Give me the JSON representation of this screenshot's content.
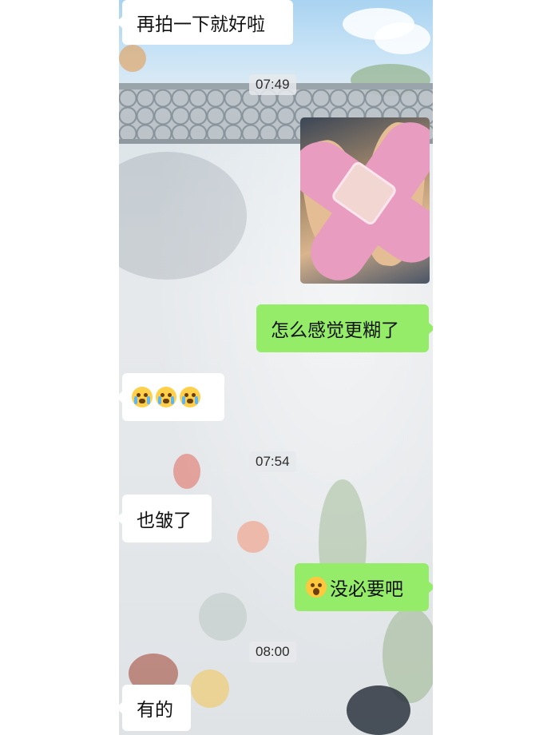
{
  "chat": {
    "messages": [
      {
        "side": "left",
        "text": "再拍一下就好啦"
      },
      {
        "timestamp": "07:49"
      },
      {
        "side": "right",
        "type": "image"
      },
      {
        "side": "right",
        "text": "怎么感觉更糊了"
      },
      {
        "side": "left",
        "type": "emoji",
        "emoji": [
          "crying-face-emoji",
          "crying-face-emoji",
          "crying-face-emoji"
        ]
      },
      {
        "timestamp": "07:54"
      },
      {
        "side": "left",
        "text": "也皱了"
      },
      {
        "side": "right",
        "emoji_prefix": "surprised-face-emoji",
        "text": "没必要吧"
      },
      {
        "timestamp": "08:00"
      },
      {
        "side": "left",
        "text": "有的"
      }
    ]
  },
  "colors": {
    "incoming_bubble": "#ffffff",
    "outgoing_bubble": "#95ec69",
    "photo_sticker": "#e79cc0"
  }
}
